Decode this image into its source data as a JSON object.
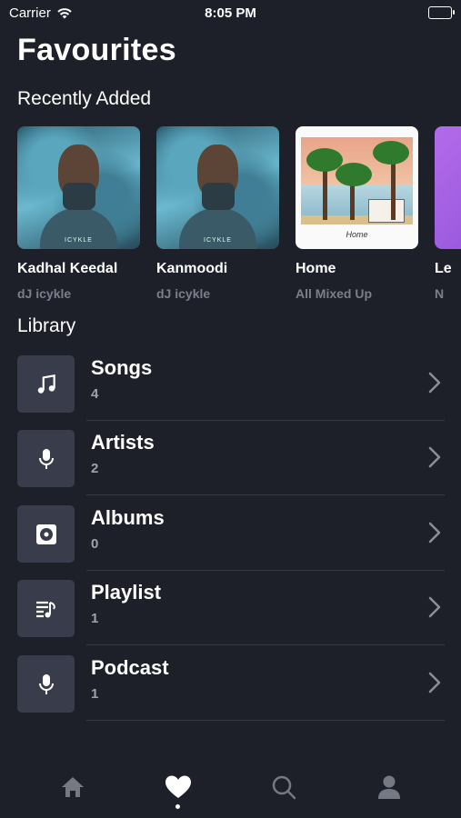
{
  "status_bar": {
    "carrier": "Carrier",
    "time": "8:05 PM"
  },
  "page_title": "Favourites",
  "recently_added": {
    "title": "Recently Added",
    "items": [
      {
        "title": "Kadhal Keedal",
        "artist": "dJ icykle",
        "art_caption": "ICYKLE"
      },
      {
        "title": "Kanmoodi",
        "artist": "dJ icykle",
        "art_caption": "ICYKLE"
      },
      {
        "title": "Home",
        "artist": "All Mixed Up",
        "art_caption": "Home"
      },
      {
        "title": "Le",
        "artist": "N"
      }
    ]
  },
  "library": {
    "title": "Library",
    "items": [
      {
        "label": "Songs",
        "count": "4",
        "icon": "music-note-icon"
      },
      {
        "label": "Artists",
        "count": "2",
        "icon": "microphone-icon"
      },
      {
        "label": "Albums",
        "count": "0",
        "icon": "album-icon"
      },
      {
        "label": "Playlist",
        "count": "1",
        "icon": "playlist-icon"
      },
      {
        "label": "Podcast",
        "count": "1",
        "icon": "microphone-icon"
      }
    ]
  },
  "tab_bar": {
    "tabs": [
      {
        "icon": "home-icon",
        "active": false
      },
      {
        "icon": "heart-icon",
        "active": true
      },
      {
        "icon": "search-icon",
        "active": false
      },
      {
        "icon": "profile-icon",
        "active": false
      }
    ]
  },
  "colors": {
    "background": "#1e2029",
    "tile": "#393c4a",
    "muted_text": "#7a7f8c",
    "tab_inactive": "#757984",
    "tab_active": "#ffffff"
  }
}
